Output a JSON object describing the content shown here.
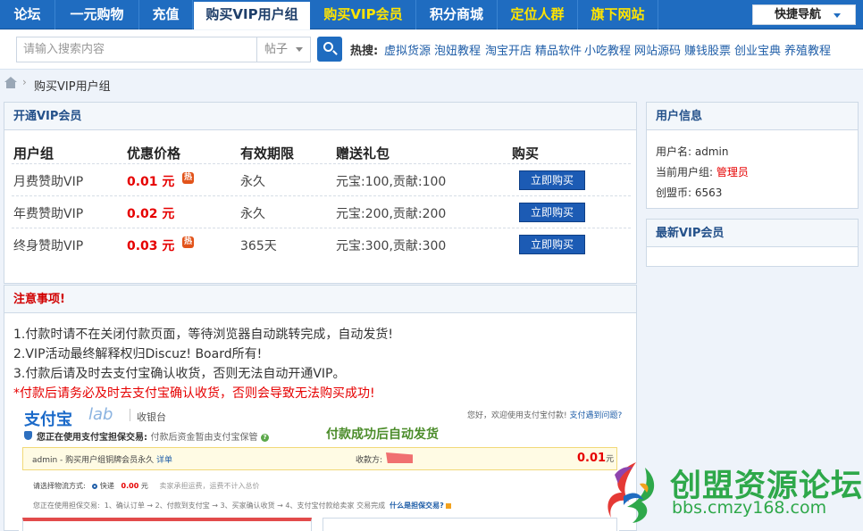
{
  "nav": {
    "items": [
      {
        "label": "论坛",
        "style": "normal"
      },
      {
        "label": "一元购物",
        "style": "normal"
      },
      {
        "label": "充值",
        "style": "normal"
      },
      {
        "label": "购买VIP用户组",
        "style": "active"
      },
      {
        "label": "购买VIP会员",
        "style": "yellow"
      },
      {
        "label": "积分商城",
        "style": "normal"
      },
      {
        "label": "定位人群",
        "style": "yellow"
      },
      {
        "label": "旗下网站",
        "style": "yellow"
      }
    ],
    "quick_nav": "快捷导航"
  },
  "search": {
    "placeholder": "请输入搜索内容",
    "scope": "帖子",
    "hot_label": "热搜:",
    "hot_links": [
      "虚拟货源",
      "泡妞教程",
      "淘宝开店",
      "精品软件",
      "小吃教程",
      "网站源码",
      "赚钱股票",
      "创业宝典",
      "养殖教程"
    ]
  },
  "breadcrumb": {
    "separator": "›",
    "current": "购买VIP用户组"
  },
  "vip_panel": {
    "title": "开通VIP会员",
    "headers": [
      "用户组",
      "优惠价格",
      "有效期限",
      "赠送礼包",
      "购买"
    ],
    "rows": [
      {
        "group": "月费赞助VIP",
        "price": "0.01 元",
        "hot": true,
        "period": "永久",
        "gift": "元宝:100,贡献:100",
        "buy": "立即购买"
      },
      {
        "group": "年费赞助VIP",
        "price": "0.02 元",
        "hot": false,
        "period": "永久",
        "gift": "元宝:200,贡献:200",
        "buy": "立即购买"
      },
      {
        "group": "终身赞助VIP",
        "price": "0.03 元",
        "hot": true,
        "period": "365天",
        "gift": "元宝:300,贡献:300",
        "buy": "立即购买"
      }
    ],
    "hot_badge": "热"
  },
  "notice": {
    "title": "注意事项!",
    "lines": [
      "1.付款时请不在关闭付款页面，等待浏览器自动跳转完成，自动发货!",
      "2.VIP活动最终解释权归Discuz! Board所有!",
      "3.付款后请及时去支付宝确认收货，否则无法自动开通VIP。"
    ],
    "warning": "*付款后请务必及时去支付宝确认收货，否则会导致无法购买成功!"
  },
  "alipay": {
    "logo": "支付宝",
    "logo_sub": "lab",
    "cashier": "收银台",
    "welcome": "您好，欢迎使用支付宝付款!",
    "welcome_link": "支付遇到问题?",
    "guarantee": "您正在使用支付宝担保交易:",
    "guarantee_sub": "付款后资金暂由支付宝保管",
    "guarantee_q": "?",
    "success_note": "付款成功后自动发货",
    "order_text": "admin - 购买用户组铜牌会员永久",
    "order_link": "详单",
    "payee_label": "收款方:",
    "amount": "0.01",
    "amount_unit": "元",
    "ship_label": "请选择物流方式:",
    "ship_option": "快递",
    "ship_fee": "0.00",
    "ship_unit": "元",
    "ship_note": "卖家承担运费，运费不计入总价",
    "steps_label": "您正在使用担保交易:",
    "steps": "1、确认订单 → 2、付款到支付宝 → 3、买家确认收货 → 4、支付宝付款给卖家 交易完成",
    "steps_link": "什么是担保交易?"
  },
  "user_info": {
    "title": "用户信息",
    "username_label": "用户名:",
    "username": "admin",
    "group_label": "当前用户组:",
    "group": "管理员",
    "coins_label": "创盟币:",
    "coins": "6563"
  },
  "latest_vip": {
    "title": "最新VIP会员"
  },
  "watermark": {
    "title": "创盟资源论坛",
    "url": "bbs.cmzy168.com"
  },
  "colors": {
    "nav_bg": "#1f6cc0",
    "accent_yellow": "#ffe400",
    "price_red": "#e60000",
    "button_blue": "#1c5bb4",
    "watermark_green": "#2ea84a"
  }
}
